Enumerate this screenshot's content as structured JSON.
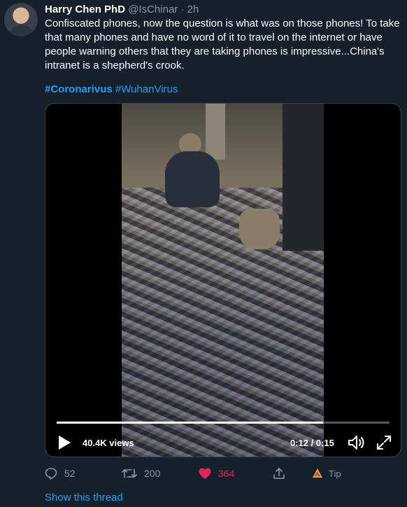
{
  "tweet": {
    "display_name": "Harry Chen PhD",
    "handle": "@IsChinar",
    "separator": "·",
    "time": "2h",
    "text": "Confiscated phones, now the question is what was on those phones! To take that many phones and have no word of it to travel on the internet or have people warning others that they are taking phones is impressive...China's intranet is a shepherd's crook.",
    "hashtags": [
      "#Coronarivus",
      "#WuhanVirus"
    ]
  },
  "video": {
    "views": "40.4K views",
    "time_readout": "0:12 / 0:15",
    "progress_fraction": 0.8,
    "icons": {
      "play": "play-icon",
      "volume": "volume-icon",
      "fullscreen": "fullscreen-icon"
    }
  },
  "actions": {
    "reply_count": "52",
    "retweet_count": "200",
    "like_count": "364",
    "tip_label": "Tip"
  },
  "footer": {
    "show_thread": "Show this thread"
  },
  "colors": {
    "background": "#15202b",
    "link": "#1da1f2",
    "muted": "#8899a6",
    "like": "#e0245e"
  }
}
